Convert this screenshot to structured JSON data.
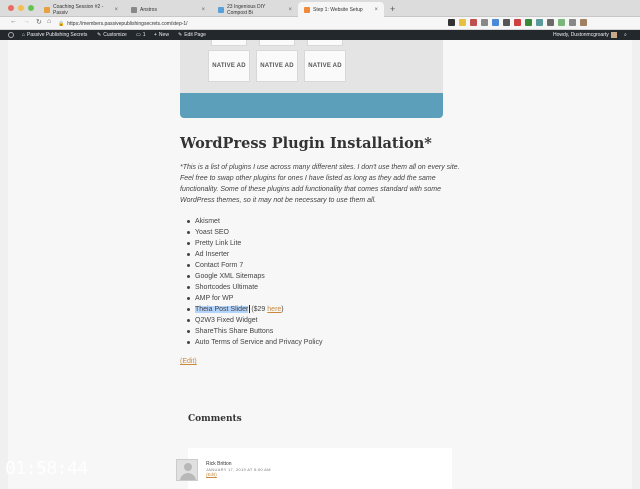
{
  "browser": {
    "tabs": [
      {
        "title": "Coaching Session #2 - Passiv",
        "fav_color": "#e8a040"
      },
      {
        "title": "Anstros",
        "fav_color": "#888888"
      },
      {
        "title": "23 Ingenious DIY Compost Bi",
        "fav_color": "#5aa0d8"
      },
      {
        "title": "Step 1: Website Setup",
        "fav_color": "#f08a3a"
      }
    ],
    "new_tab": "+",
    "close": "×",
    "url": "https://members.passivepublishingsecrets.com/step-1/",
    "extension_colors": [
      "#333333",
      "#e8c040",
      "#c05050",
      "#888888",
      "#4a8ad8",
      "#555555",
      "#d04040",
      "#3a8a3a",
      "#5a9a9a",
      "#6a6a6a",
      "#7ab87a",
      "#888888",
      "#a08060"
    ]
  },
  "wp_bar": {
    "site_name": "Passive Publishing Secrets",
    "customize": "Customize",
    "comments_count": "1",
    "new": "New",
    "edit_page": "Edit Page",
    "howdy": "Howdy, Dustonmcgroarty"
  },
  "hero": {
    "ads": [
      "NATIVE AD",
      "NATIVE AD",
      "NATIVE AD"
    ],
    "band_color": "#5c9fbb"
  },
  "content": {
    "title": "WordPress Plugin Installation*",
    "intro": "*This is a list of plugins I use across many different sites. I don't use them all on every site. Feel free to swap other plugins for ones I have listed as long as they add the same functionality. Some of these plugins add functionality that comes standard with some WordPress themes, so it may not be necessary to use them all.",
    "plugins": [
      "Akismet",
      "Yoast SEO",
      "Pretty Link Lite",
      "Ad Inserter",
      "Contact Form 7",
      "Google XML Sitemaps",
      "Shortcodes Ultimate",
      "AMP for WP",
      "Theia Post Slider",
      "Q2W3 Fixed Widget",
      "ShareThis Share Buttons",
      "Auto Terms of Service and Privacy Policy"
    ],
    "theia_price_prefix": "($29",
    "theia_link": "here",
    "theia_suffix": ")",
    "edit_link": "(Edit)"
  },
  "comments": {
    "heading": "Comments",
    "items": [
      {
        "author": "Rick Britton",
        "date": "JANUARY 17, 2019 AT 5:00 AM",
        "edit": "(Edit)"
      }
    ]
  },
  "overlay": {
    "timer": "01:58:44"
  }
}
